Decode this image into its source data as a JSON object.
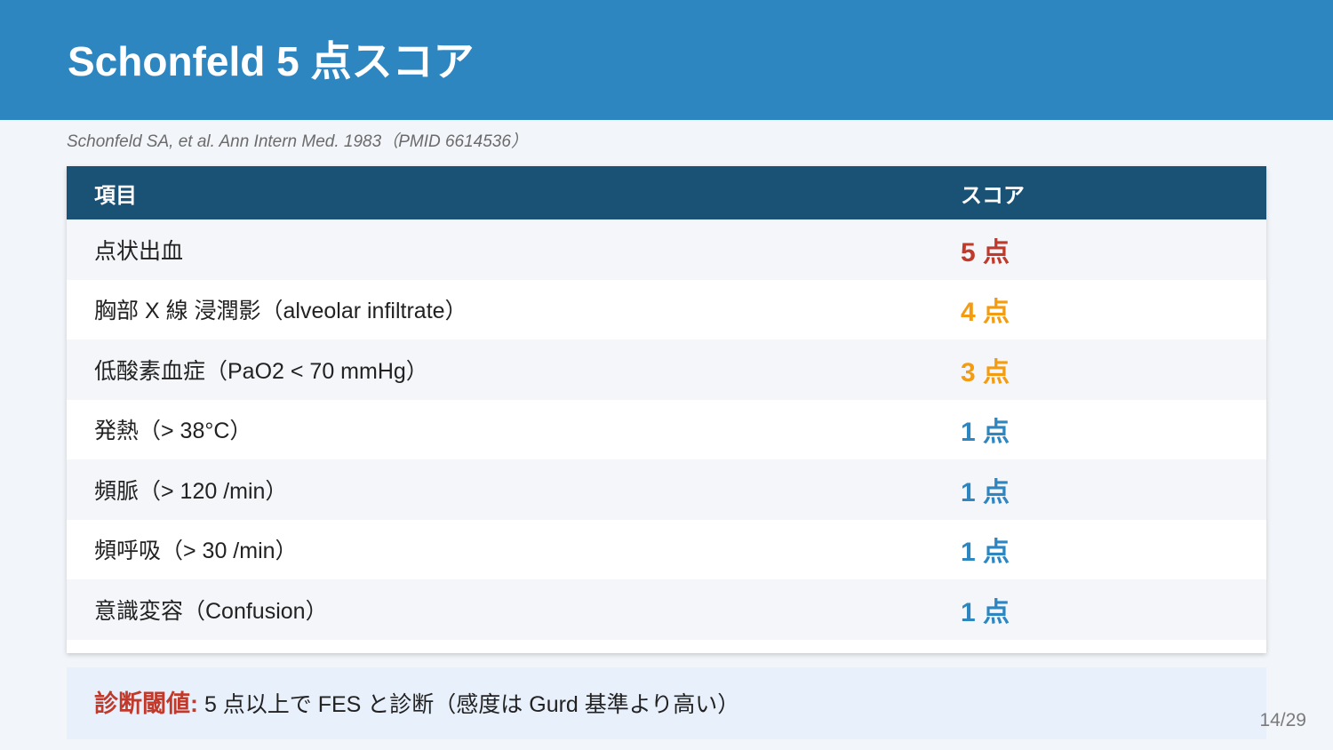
{
  "slide": {
    "title": "Schonfeld 5 点スコア",
    "citation": "Schonfeld SA, et al. Ann Intern Med. 1983（PMID 6614536）",
    "page_number": "14/29"
  },
  "table": {
    "headers": {
      "item": "項目",
      "score": "スコア"
    },
    "rows": [
      {
        "item": "点状出血",
        "score": "5 点",
        "score_color": "#c0392b"
      },
      {
        "item": "胸部 X 線 浸潤影（alveolar infiltrate）",
        "score": "4 点",
        "score_color": "#f39c12"
      },
      {
        "item": "低酸素血症（PaO2 < 70 mmHg）",
        "score": "3 点",
        "score_color": "#f39c12"
      },
      {
        "item": "発熱（> 38°C）",
        "score": "1 点",
        "score_color": "#2e86c1"
      },
      {
        "item": "頻脈（> 120 /min）",
        "score": "1 点",
        "score_color": "#2e86c1"
      },
      {
        "item": "頻呼吸（> 30 /min）",
        "score": "1 点",
        "score_color": "#2e86c1"
      },
      {
        "item": "意識変容（Confusion）",
        "score": "1 点",
        "score_color": "#2e86c1"
      }
    ]
  },
  "footer": {
    "label": "診断閾値:",
    "text": " 5 点以上で FES と診断（感度は Gurd 基準より高い）"
  },
  "colors": {
    "header_bg": "#2e86c1",
    "table_header_bg": "#1a5276",
    "label_red": "#c0392b",
    "score_orange": "#f39c12",
    "score_blue": "#2e86c1"
  }
}
